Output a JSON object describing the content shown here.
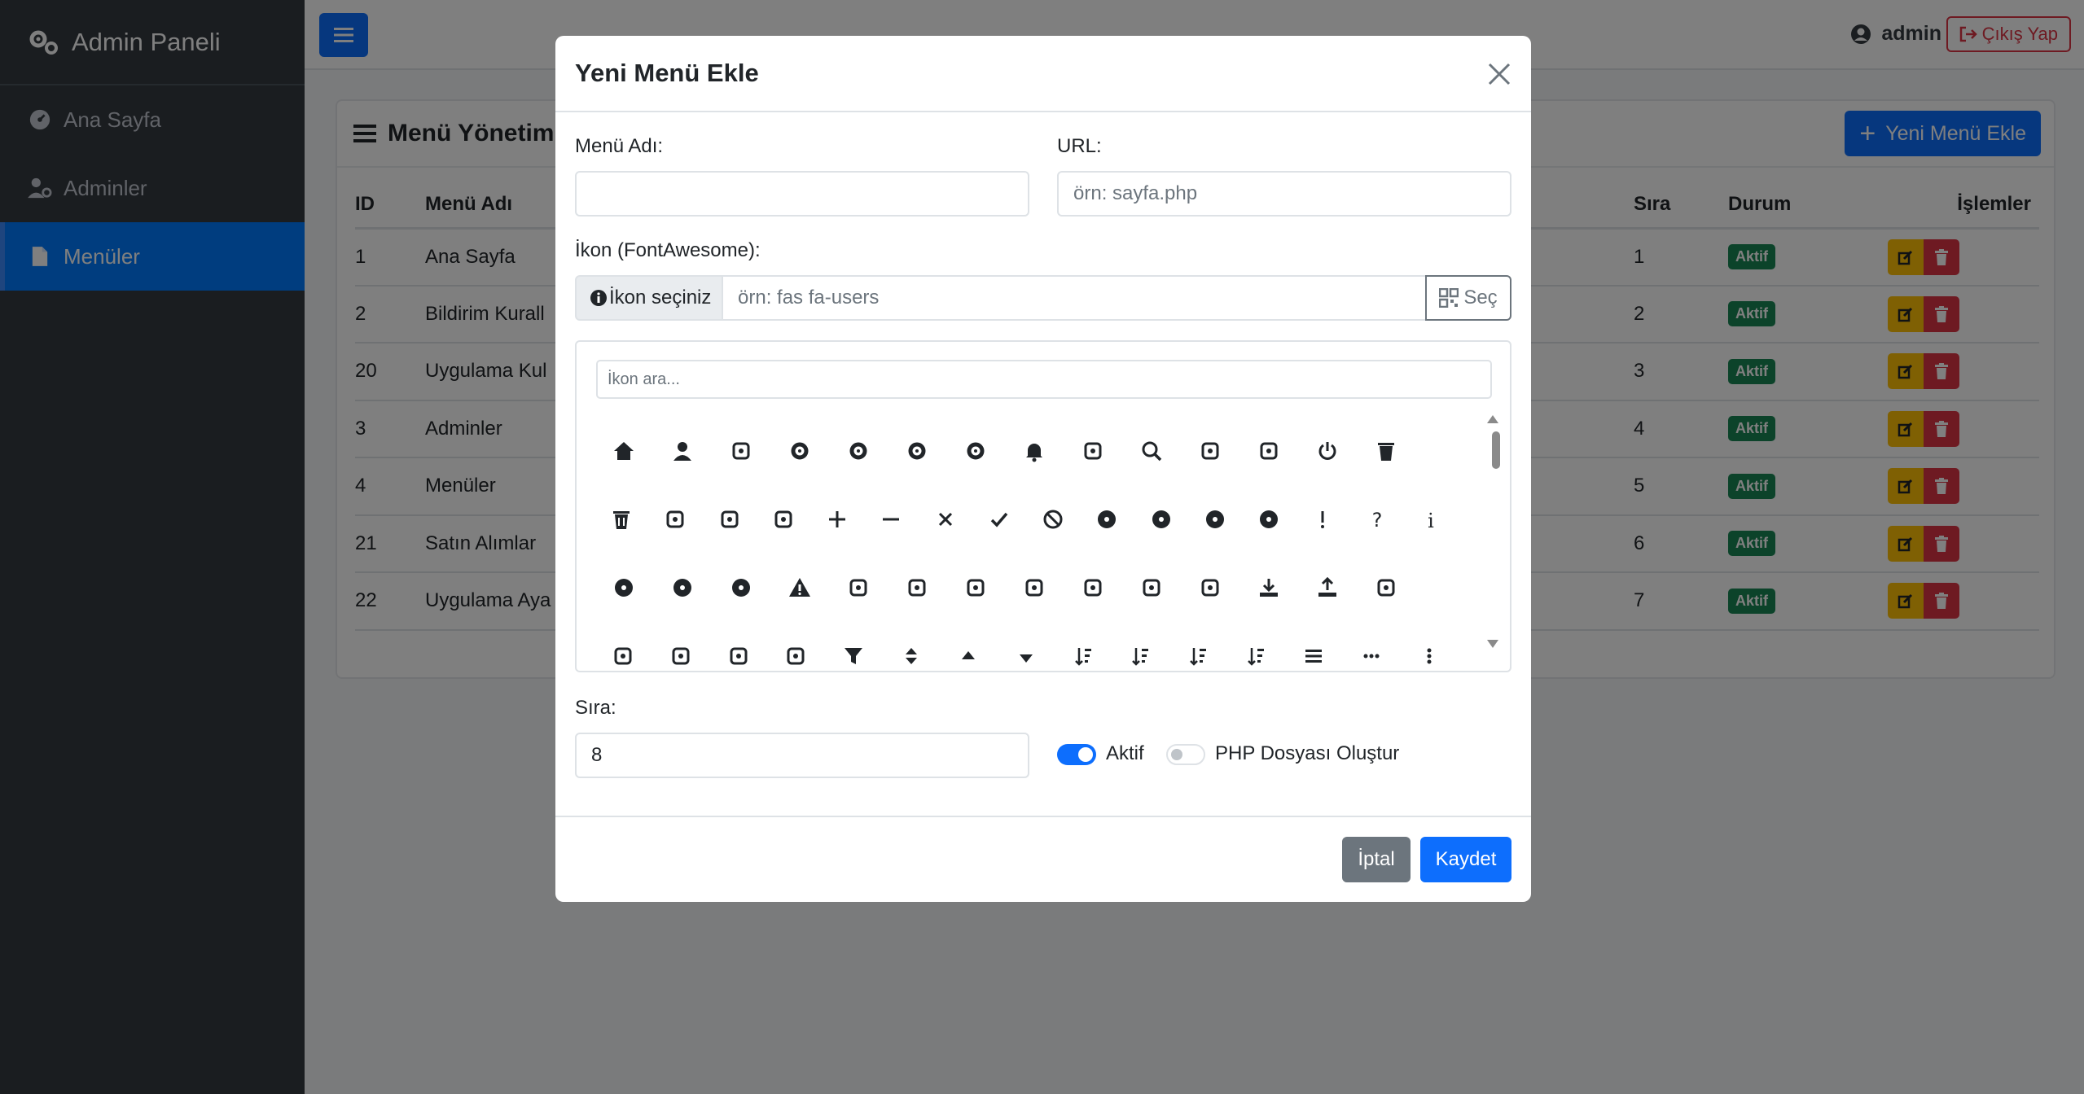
{
  "sidebar": {
    "brand": "Admin Paneli",
    "items": [
      {
        "label": "Ana Sayfa",
        "icon": "gauge-icon"
      },
      {
        "label": "Adminler",
        "icon": "user-gear-icon"
      },
      {
        "label": "Menüler",
        "icon": "file-icon",
        "active": true
      }
    ]
  },
  "topbar": {
    "user": "admin",
    "logout": "Çıkış Yap"
  },
  "card": {
    "title": "Menü Yönetimi",
    "new_button": "Yeni Menü Ekle",
    "columns": {
      "id": "ID",
      "name": "Menü Adı",
      "order": "Sıra",
      "status": "Durum",
      "actions": "İşlemler"
    },
    "rows": [
      {
        "id": "1",
        "name": "Ana Sayfa",
        "order": "1",
        "status": "Aktif"
      },
      {
        "id": "2",
        "name": "Bildirim Kurall",
        "order": "2",
        "status": "Aktif"
      },
      {
        "id": "20",
        "name": "Uygulama Kul",
        "order": "3",
        "status": "Aktif"
      },
      {
        "id": "3",
        "name": "Adminler",
        "order": "4",
        "status": "Aktif"
      },
      {
        "id": "4",
        "name": "Menüler",
        "order": "5",
        "status": "Aktif"
      },
      {
        "id": "21",
        "name": "Satın Alımlar",
        "order": "6",
        "status": "Aktif"
      },
      {
        "id": "22",
        "name": "Uygulama Aya",
        "order": "7",
        "status": "Aktif"
      }
    ]
  },
  "modal": {
    "title": "Yeni Menü Ekle",
    "name_label": "Menü Adı:",
    "name_value": "",
    "url_label": "URL:",
    "url_placeholder": "örn: sayfa.php",
    "icon_label": "İkon (FontAwesome):",
    "icon_prefix": "İkon seçiniz",
    "icon_placeholder": "örn: fas fa-users",
    "icon_button": "Seç",
    "icon_search_placeholder": "İkon ara...",
    "icon_rows": [
      [
        "house-icon",
        "user-icon",
        "users-icon",
        "gear-icon",
        "cog-icon",
        "gears-icon",
        "cogs-icon",
        "bell-icon",
        "bell-slash-icon",
        "magnifying-glass-icon",
        "zoom-in-icon",
        "zoom-out-icon",
        "power-icon",
        "trash-icon"
      ],
      [
        "trash-can-icon",
        "edit-icon",
        "pencil-icon",
        "pencil-outline-icon",
        "plus-icon",
        "minus-icon",
        "times-icon",
        "check-icon",
        "ban-icon",
        "circle-plus-icon",
        "circle-minus-icon",
        "circle-xmark-icon",
        "circle-check-icon",
        "exclamation-icon",
        "question-icon",
        "info-icon"
      ],
      [
        "circle-exclamation-icon",
        "circle-question-icon",
        "circle-info-icon",
        "triangle-exclamation-icon",
        "sign-in-icon",
        "sign-out-icon",
        "external-link-icon",
        "link-icon",
        "unlink-icon",
        "share-icon",
        "share-square-icon",
        "download-icon",
        "upload-icon",
        "print-icon"
      ],
      [
        "sync-icon",
        "redo-icon",
        "undo-icon",
        "history-icon",
        "filter-icon",
        "sort-icon",
        "sort-up-icon",
        "sort-down-icon",
        "sort-amount-down-icon",
        "sort-amount-up-icon",
        "sort-numeric-down-icon",
        "sort-numeric-up-icon",
        "bars-icon",
        "ellipsis-h-icon",
        "ellipsis-v-icon"
      ]
    ],
    "order_label": "Sıra:",
    "order_value": "8",
    "active_label": "Aktif",
    "active_on": true,
    "php_label": "PHP Dosyası Oluştur",
    "php_on": false,
    "cancel": "İptal",
    "save": "Kaydet"
  }
}
